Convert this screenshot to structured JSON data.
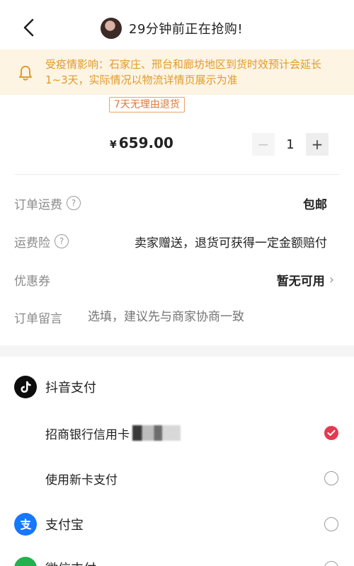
{
  "header": {
    "title": "29分钟前正在抢购!"
  },
  "notice": {
    "text": "受疫情影响：石家庄、邢台和廊坊地区到货时效预计会延长1~3天，实际情况以物流详情页展示为准"
  },
  "product": {
    "badge": "7天无理由退货",
    "currency": "¥",
    "price": "659.00",
    "quantity": "1",
    "minus_label": "−",
    "plus_label": "+"
  },
  "order": {
    "shipping_label": "订单运费",
    "shipping_value": "包邮",
    "insurance_label": "运费险",
    "insurance_value": "卖家赠送，退货可获得一定金额赔付",
    "coupon_label": "优惠券",
    "coupon_value": "暂无可用",
    "memo_label": "订单留言",
    "memo_placeholder": "选填，建议先与商家协商一致"
  },
  "payment": {
    "douyin_label": "抖音支付",
    "card_label": "招商银行信用卡",
    "new_card_label": "使用新卡支付",
    "alipay_label": "支付宝",
    "wechat_label": "微信支付",
    "selected": "card",
    "accent_color": "#e33a4f"
  }
}
